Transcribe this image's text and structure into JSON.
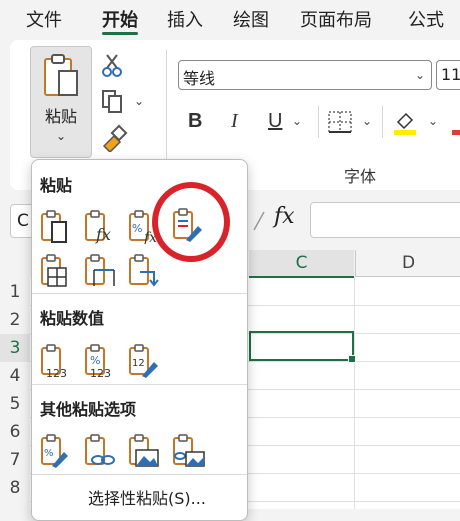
{
  "menu": {
    "tabs": [
      "文件",
      "开始",
      "插入",
      "绘图",
      "页面布局",
      "公式"
    ],
    "active_tab": "开始"
  },
  "ribbon": {
    "paste_label": "粘贴",
    "font_name": "等线",
    "font_size": "11",
    "format_buttons": [
      "B",
      "I",
      "U"
    ],
    "font_group_label": "字体"
  },
  "formula_bar": {
    "name_box": "C",
    "fx": "fx"
  },
  "grid": {
    "columns": [
      "C",
      "D"
    ],
    "rows": [
      "1",
      "2",
      "3",
      "4",
      "5",
      "6",
      "7",
      "8"
    ],
    "selected_row": "3",
    "selected_column": "C",
    "accent_color": "#1e7145"
  },
  "paste_menu": {
    "section1": "粘贴",
    "section2": "粘贴数值",
    "section3": "其他粘贴选项",
    "special_link": "选择性粘贴(S)...",
    "highlight_color": "#d9232a"
  }
}
